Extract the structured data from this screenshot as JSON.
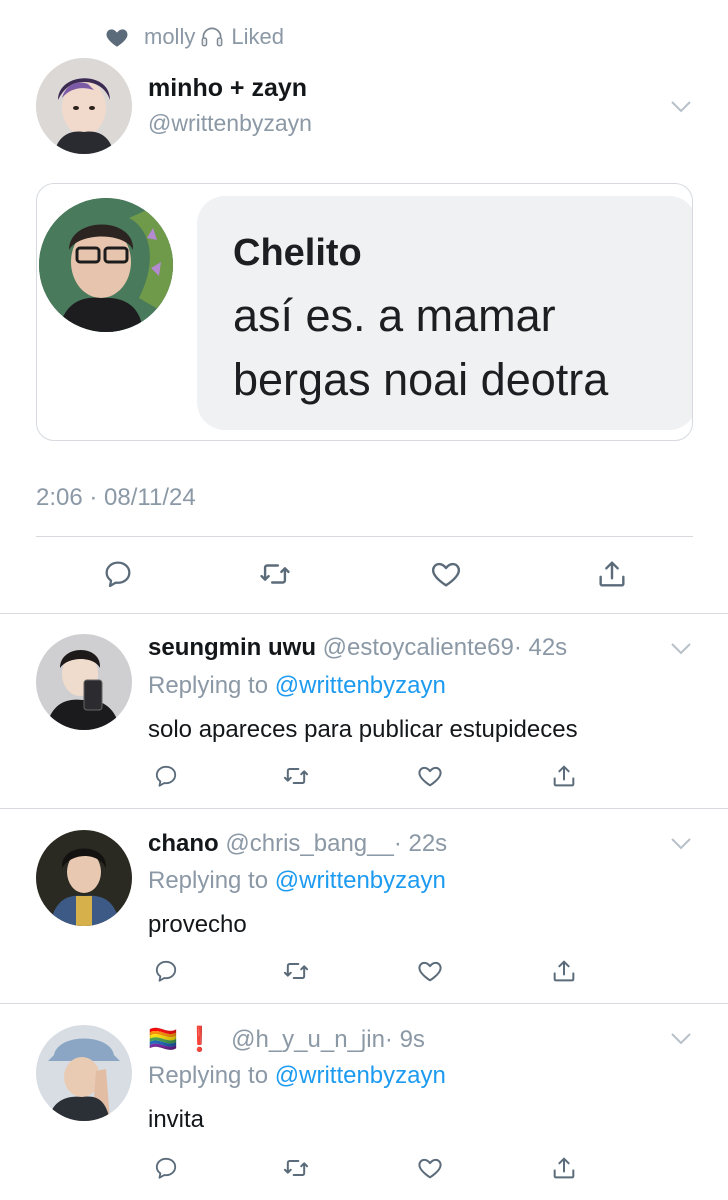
{
  "social_context": {
    "icon": "heart-icon",
    "user": "molly",
    "emoji": "headphones-icon",
    "action": "Liked"
  },
  "main_tweet": {
    "display_name": "minho + zayn",
    "handle": "@writtenbyzayn",
    "image": {
      "comment_author": "Chelito",
      "comment_line1": "así es. a mamar",
      "comment_line2": "bergas noai deotra"
    },
    "timestamp": "2:06 · 08/11/24"
  },
  "replies": [
    {
      "name": "seungmin uwu",
      "handle": "@estoycaliente69",
      "time": "· 42s",
      "replying_label": "Replying to",
      "replying_to": "@writtenbyzayn",
      "text": "solo apareces para publicar estupideces"
    },
    {
      "name": "chano",
      "handle": "@chris_bang__",
      "time": "· 22s",
      "replying_label": "Replying to",
      "replying_to": "@writtenbyzayn",
      "text": "provecho"
    },
    {
      "name": "🏳️‍🌈 ❗",
      "handle": "@h_y_u_n_jin",
      "time": "· 9s",
      "replying_label": "Replying to",
      "replying_to": "@writtenbyzayn",
      "text": "invita"
    }
  ],
  "colors": {
    "link": "#1d9bf0",
    "muted": "#8b98a5",
    "divider": "#d6dadf",
    "text": "#14171a"
  }
}
